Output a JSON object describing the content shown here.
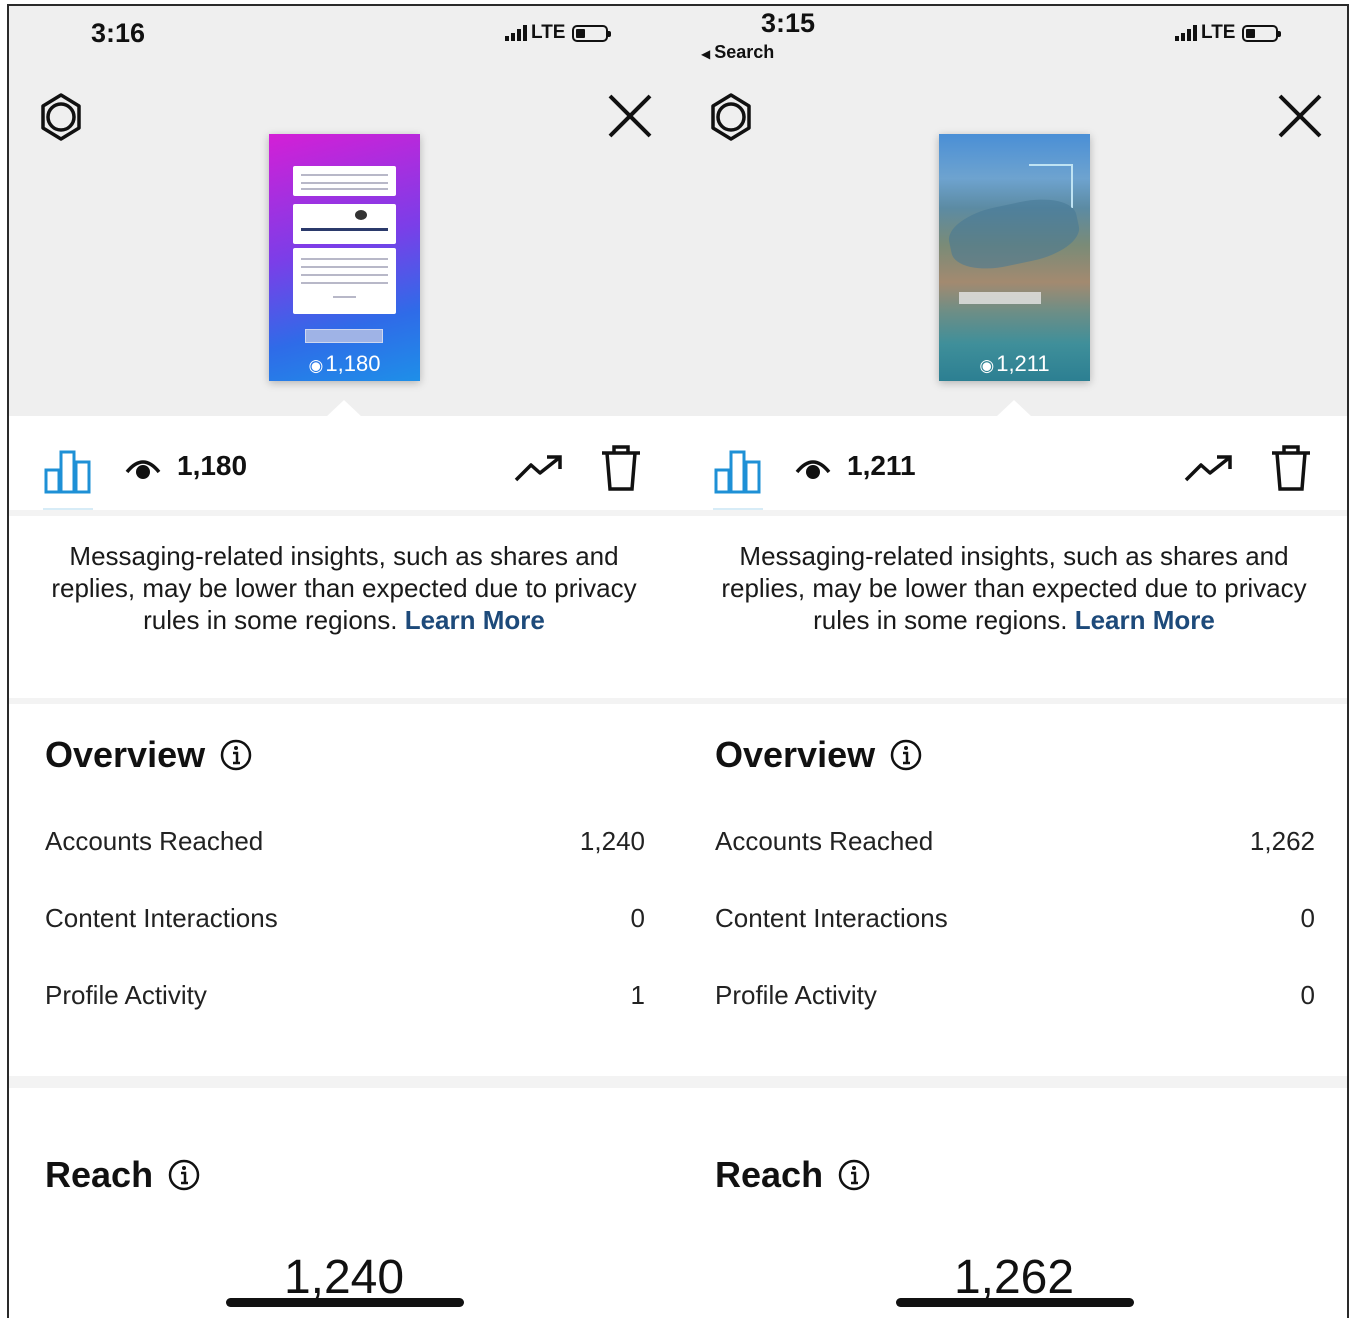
{
  "panels": [
    {
      "status": {
        "time": "3:16",
        "network": "LTE",
        "back": null
      },
      "story": {
        "views": "1,180"
      },
      "toolbar": {
        "views": "1,180"
      },
      "notice": {
        "text": "Messaging-related insights, such as shares and replies, may be lower than expected due to privacy rules in some regions.",
        "link": "Learn More"
      },
      "overview": {
        "title": "Overview",
        "rows": [
          {
            "label": "Accounts Reached",
            "value": "1,240"
          },
          {
            "label": "Content Interactions",
            "value": "0"
          },
          {
            "label": "Profile Activity",
            "value": "1"
          }
        ]
      },
      "reach": {
        "title": "Reach",
        "value": "1,240"
      }
    },
    {
      "status": {
        "time": "3:15",
        "network": "LTE",
        "back": "Search"
      },
      "story": {
        "views": "1,211"
      },
      "toolbar": {
        "views": "1,211"
      },
      "notice": {
        "text": "Messaging-related insights, such as shares and replies, may be lower than expected due to privacy rules in some regions.",
        "link": "Learn More"
      },
      "overview": {
        "title": "Overview",
        "rows": [
          {
            "label": "Accounts Reached",
            "value": "1,262"
          },
          {
            "label": "Content Interactions",
            "value": "0"
          },
          {
            "label": "Profile Activity",
            "value": "0"
          }
        ]
      },
      "reach": {
        "title": "Reach",
        "value": "1,262"
      }
    }
  ],
  "colors": {
    "accent": "#1e90d6",
    "link": "#1d4a7a",
    "header_bg": "#efefef"
  },
  "icons": [
    "gear-icon",
    "close-icon",
    "bar-chart-icon",
    "eye-icon",
    "trend-icon",
    "trash-icon",
    "info-icon",
    "back-arrow-icon"
  ]
}
